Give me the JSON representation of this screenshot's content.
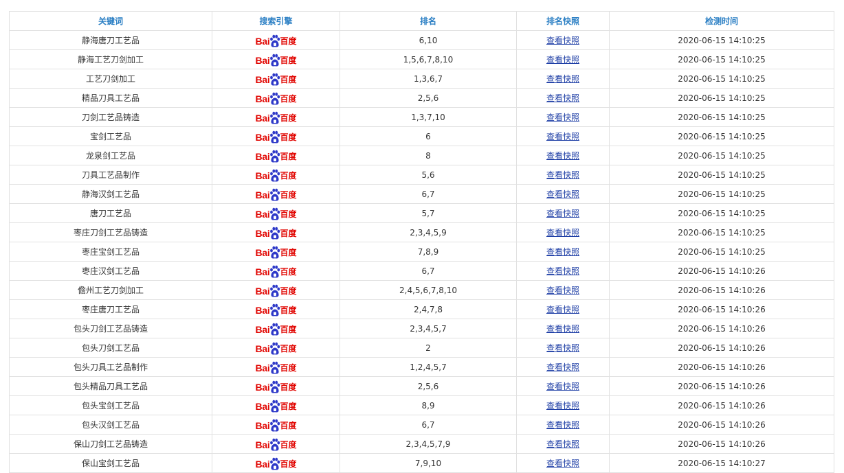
{
  "table": {
    "headers": [
      "关键词",
      "搜索引擎",
      "排名",
      "排名快照",
      "检测时间"
    ],
    "engine_logo": {
      "icon": "baidu-paw-icon",
      "text_left": "Bai",
      "text_right": "百度",
      "color": "#e10602",
      "paw_color": "#2d38c8"
    },
    "snapshot_label": "查看快照",
    "rows": [
      {
        "keyword": "静海唐刀工艺品",
        "rank": "6,10",
        "time": "2020-06-15 14:10:25"
      },
      {
        "keyword": "静海工艺刀剑加工",
        "rank": "1,5,6,7,8,10",
        "time": "2020-06-15 14:10:25"
      },
      {
        "keyword": "工艺刀剑加工",
        "rank": "1,3,6,7",
        "time": "2020-06-15 14:10:25"
      },
      {
        "keyword": "精品刀具工艺品",
        "rank": "2,5,6",
        "time": "2020-06-15 14:10:25"
      },
      {
        "keyword": "刀剑工艺品铸造",
        "rank": "1,3,7,10",
        "time": "2020-06-15 14:10:25"
      },
      {
        "keyword": "宝剑工艺品",
        "rank": "6",
        "time": "2020-06-15 14:10:25"
      },
      {
        "keyword": "龙泉剑工艺品",
        "rank": "8",
        "time": "2020-06-15 14:10:25"
      },
      {
        "keyword": "刀具工艺品制作",
        "rank": "5,6",
        "time": "2020-06-15 14:10:25"
      },
      {
        "keyword": "静海汉剑工艺品",
        "rank": "6,7",
        "time": "2020-06-15 14:10:25"
      },
      {
        "keyword": "唐刀工艺品",
        "rank": "5,7",
        "time": "2020-06-15 14:10:25"
      },
      {
        "keyword": "枣庄刀剑工艺品铸造",
        "rank": "2,3,4,5,9",
        "time": "2020-06-15 14:10:25"
      },
      {
        "keyword": "枣庄宝剑工艺品",
        "rank": "7,8,9",
        "time": "2020-06-15 14:10:25"
      },
      {
        "keyword": "枣庄汉剑工艺品",
        "rank": "6,7",
        "time": "2020-06-15 14:10:26"
      },
      {
        "keyword": "儋州工艺刀剑加工",
        "rank": "2,4,5,6,7,8,10",
        "time": "2020-06-15 14:10:26"
      },
      {
        "keyword": "枣庄唐刀工艺品",
        "rank": "2,4,7,8",
        "time": "2020-06-15 14:10:26"
      },
      {
        "keyword": "包头刀剑工艺品铸造",
        "rank": "2,3,4,5,7",
        "time": "2020-06-15 14:10:26"
      },
      {
        "keyword": "包头刀剑工艺品",
        "rank": "2",
        "time": "2020-06-15 14:10:26"
      },
      {
        "keyword": "包头刀具工艺品制作",
        "rank": "1,2,4,5,7",
        "time": "2020-06-15 14:10:26"
      },
      {
        "keyword": "包头精品刀具工艺品",
        "rank": "2,5,6",
        "time": "2020-06-15 14:10:26"
      },
      {
        "keyword": "包头宝剑工艺品",
        "rank": "8,9",
        "time": "2020-06-15 14:10:26"
      },
      {
        "keyword": "包头汉剑工艺品",
        "rank": "6,7",
        "time": "2020-06-15 14:10:26"
      },
      {
        "keyword": "保山刀剑工艺品铸造",
        "rank": "2,3,4,5,7,9",
        "time": "2020-06-15 14:10:26"
      },
      {
        "keyword": "保山宝剑工艺品",
        "rank": "7,9,10",
        "time": "2020-06-15 14:10:27"
      }
    ]
  }
}
